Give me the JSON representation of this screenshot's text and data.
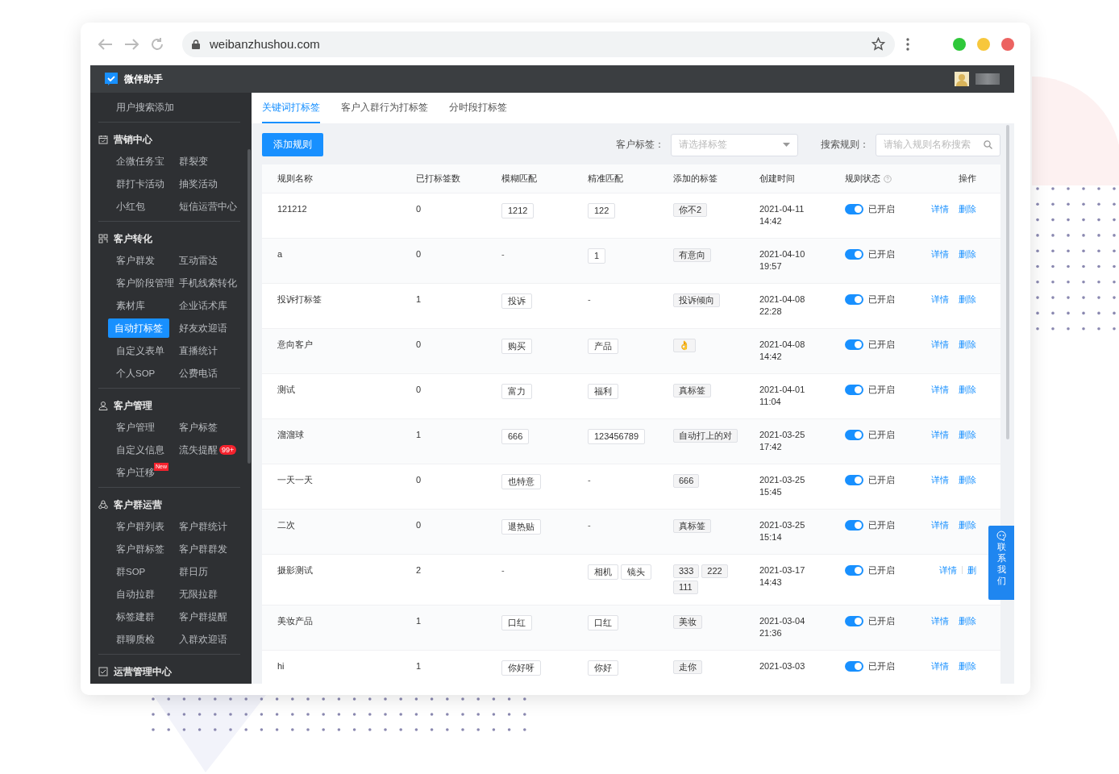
{
  "browser": {
    "url": "weibanzhushou.com"
  },
  "app": {
    "title": "微伴助手"
  },
  "sidebar": {
    "sections": [
      {
        "items": [
          {
            "label": "用户搜索添加",
            "selected": false
          }
        ]
      },
      {
        "title": "营销中心",
        "items": [
          {
            "label": "企微任务宝",
            "selected": false
          },
          {
            "label": "群裂变",
            "selected": false
          },
          {
            "label": "群打卡活动",
            "selected": false
          },
          {
            "label": "抽奖活动",
            "selected": false
          },
          {
            "label": "小红包",
            "selected": false
          },
          {
            "label": "短信运营中心",
            "selected": false
          }
        ]
      },
      {
        "title": "客户转化",
        "items": [
          {
            "label": "客户群发",
            "selected": false
          },
          {
            "label": "互动雷达",
            "selected": false
          },
          {
            "label": "客户阶段管理",
            "selected": false
          },
          {
            "label": "手机线索转化",
            "selected": false
          },
          {
            "label": "素材库",
            "selected": false
          },
          {
            "label": "企业话术库",
            "selected": false
          },
          {
            "label": "自动打标签",
            "selected": true
          },
          {
            "label": "好友欢迎语",
            "selected": false
          },
          {
            "label": "自定义表单",
            "selected": false
          },
          {
            "label": "直播统计",
            "selected": false
          },
          {
            "label": "个人SOP",
            "selected": false
          },
          {
            "label": "公费电话",
            "selected": false
          }
        ]
      },
      {
        "title": "客户管理",
        "items": [
          {
            "label": "客户管理",
            "selected": false
          },
          {
            "label": "客户标签",
            "selected": false
          },
          {
            "label": "自定义信息",
            "selected": false
          },
          {
            "label": "流失提醒",
            "selected": false,
            "badge": {
              "kind": "count",
              "text": "99+"
            }
          },
          {
            "label": "客户迁移",
            "selected": false,
            "badge": {
              "kind": "new",
              "text": "New"
            }
          }
        ]
      },
      {
        "title": "客户群运营",
        "items": [
          {
            "label": "客户群列表",
            "selected": false
          },
          {
            "label": "客户群统计",
            "selected": false
          },
          {
            "label": "客户群标签",
            "selected": false
          },
          {
            "label": "客户群群发",
            "selected": false
          },
          {
            "label": "群SOP",
            "selected": false
          },
          {
            "label": "群日历",
            "selected": false
          },
          {
            "label": "自动拉群",
            "selected": false
          },
          {
            "label": "无限拉群",
            "selected": false
          },
          {
            "label": "标签建群",
            "selected": false
          },
          {
            "label": "客户群提醒",
            "selected": false
          },
          {
            "label": "群聊质检",
            "selected": false
          },
          {
            "label": "入群欢迎语",
            "selected": false
          }
        ]
      },
      {
        "title": "运营管理中心"
      }
    ]
  },
  "tabs": [
    {
      "label": "关键词打标签",
      "selected": true
    },
    {
      "label": "客户入群行为打标签",
      "selected": false
    },
    {
      "label": "分时段打标签",
      "selected": false
    }
  ],
  "toolbar": {
    "add_button": "添加规则",
    "tag_label": "客户标签：",
    "tag_select": {
      "placeholder": "请选择标签"
    },
    "search_label": "搜索规则：",
    "search": {
      "placeholder": "请输入规则名称搜索"
    }
  },
  "table": {
    "columns": [
      "规则名称",
      "已打标签数",
      "模糊匹配",
      "精准匹配",
      "添加的标签",
      "创建时间",
      "规则状态",
      "操作"
    ],
    "rows": [
      {
        "name": "121212",
        "count": "0",
        "fuzzy": [
          "1212"
        ],
        "exact": [
          "122"
        ],
        "tags": [
          "你不2"
        ],
        "date": "2021-04-11",
        "time": "14:42",
        "enabled": true,
        "status": "已开启",
        "actions": [
          "详情",
          "删除"
        ]
      },
      {
        "name": "a",
        "count": "0",
        "fuzzy": "-",
        "exact": [
          "1"
        ],
        "tags": [
          "有意向"
        ],
        "date": "2021-04-10",
        "time": "19:57",
        "enabled": true,
        "status": "已开启",
        "actions": [
          "详情",
          "删除"
        ]
      },
      {
        "name": "投诉打标签",
        "count": "1",
        "fuzzy": [
          "投诉"
        ],
        "exact": "-",
        "tags": [
          "投诉倾向"
        ],
        "date": "2021-04-08",
        "time": "22:28",
        "enabled": true,
        "status": "已开启",
        "actions": [
          "详情",
          "删除"
        ]
      },
      {
        "name": "意向客户",
        "count": "0",
        "fuzzy": [
          "购买"
        ],
        "exact": [
          "产品"
        ],
        "tags": [
          "👌"
        ],
        "date": "2021-04-08",
        "time": "14:42",
        "enabled": true,
        "status": "已开启",
        "actions": [
          "详情",
          "删除"
        ]
      },
      {
        "name": "测试",
        "count": "0",
        "fuzzy": [
          "富力"
        ],
        "exact": [
          "福利"
        ],
        "tags": [
          "真标签"
        ],
        "date": "2021-04-01",
        "time": "11:04",
        "enabled": true,
        "status": "已开启",
        "actions": [
          "详情",
          "删除"
        ]
      },
      {
        "name": "溜溜球",
        "count": "1",
        "fuzzy": [
          "666"
        ],
        "exact": [
          "123456789"
        ],
        "tags": [
          "自动打上的对"
        ],
        "date": "2021-03-25",
        "time": "17:42",
        "enabled": true,
        "status": "已开启",
        "actions": [
          "详情",
          "删除"
        ]
      },
      {
        "name": "一天一天",
        "count": "0",
        "fuzzy": [
          "也特意"
        ],
        "exact": "-",
        "tags": [
          "666"
        ],
        "date": "2021-03-25",
        "time": "15:45",
        "enabled": true,
        "status": "已开启",
        "actions": [
          "详情",
          "删除"
        ]
      },
      {
        "name": "二次",
        "count": "0",
        "fuzzy": [
          "退热贴"
        ],
        "exact": "-",
        "tags": [
          "真标签"
        ],
        "date": "2021-03-25",
        "time": "15:14",
        "enabled": true,
        "status": "已开启",
        "actions": [
          "详情",
          "删除"
        ]
      },
      {
        "name": "摄影测试",
        "count": "2",
        "fuzzy": "-",
        "exact": [
          "相机",
          "镜头"
        ],
        "tags": [
          "333",
          "222",
          "111"
        ],
        "date": "2021-03-17",
        "time": "14:43",
        "enabled": true,
        "status": "已开启",
        "actions": [
          "详情",
          "删"
        ]
      },
      {
        "name": "美妆产品",
        "count": "1",
        "fuzzy": [
          "口红"
        ],
        "exact": [
          "口红"
        ],
        "tags": [
          "美妆"
        ],
        "date": "2021-03-04",
        "time": "21:36",
        "enabled": true,
        "status": "已开启",
        "actions": [
          "详情",
          "删除"
        ]
      },
      {
        "name": "hi",
        "count": "1",
        "fuzzy": [
          "你好呀"
        ],
        "exact": [
          "你好"
        ],
        "tags": [
          "走你"
        ],
        "date": "2021-03-03",
        "enabled": true,
        "status": "已开启",
        "actions": [
          "详情",
          "删除"
        ]
      }
    ]
  },
  "contact_button": [
    "联",
    "系",
    "我",
    "们"
  ]
}
